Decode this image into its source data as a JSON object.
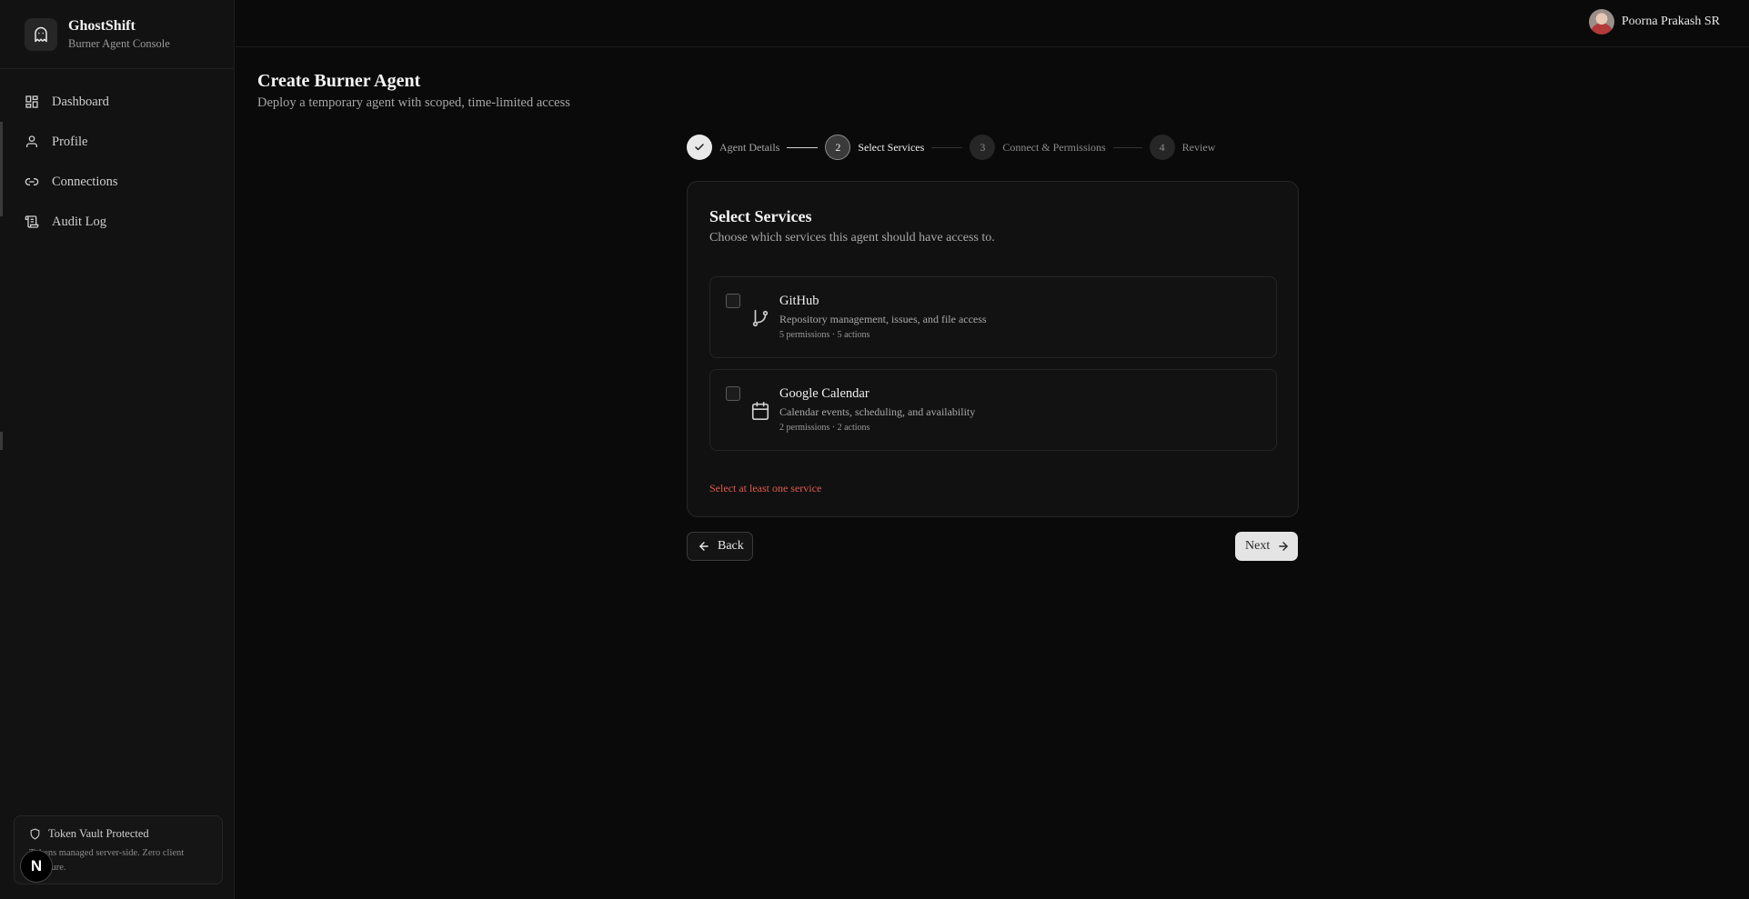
{
  "brand": {
    "name": "GhostShift",
    "subtitle": "Burner Agent Console"
  },
  "sidebar": {
    "items": [
      {
        "label": "Dashboard",
        "icon": "grid-icon"
      },
      {
        "label": "Profile",
        "icon": "user-icon"
      },
      {
        "label": "Connections",
        "icon": "link-icon"
      },
      {
        "label": "Audit Log",
        "icon": "scroll-icon"
      }
    ],
    "vault": {
      "title": "Token Vault Protected",
      "text": "Tokens managed server-side. Zero client exposure."
    },
    "badge": "N"
  },
  "header": {
    "user_name": "Poorna Prakash SR"
  },
  "page": {
    "title": "Create Burner Agent",
    "subtitle": "Deploy a temporary agent with scoped, time-limited access"
  },
  "stepper": {
    "steps": [
      {
        "number": "1",
        "label": "Agent Details",
        "state": "done"
      },
      {
        "number": "2",
        "label": "Select Services",
        "state": "active"
      },
      {
        "number": "3",
        "label": "Connect & Permissions",
        "state": "pending"
      },
      {
        "number": "4",
        "label": "Review",
        "state": "pending"
      }
    ]
  },
  "card": {
    "title": "Select Services",
    "subtitle": "Choose which services this agent should have access to.",
    "services": [
      {
        "name": "GitHub",
        "description": "Repository management, issues, and file access",
        "meta": "5 permissions · 5 actions",
        "icon": "git-branch-icon",
        "checked": false
      },
      {
        "name": "Google Calendar",
        "description": "Calendar events, scheduling, and availability",
        "meta": "2 permissions · 2 actions",
        "icon": "calendar-icon",
        "checked": false
      }
    ],
    "error": "Select at least one service"
  },
  "actions": {
    "back_label": "Back",
    "next_label": "Next"
  },
  "colors": {
    "background": "#0a0a0a",
    "sidebar": "#121212",
    "error": "#e05a4f",
    "next_button": "#e4e4e4"
  }
}
